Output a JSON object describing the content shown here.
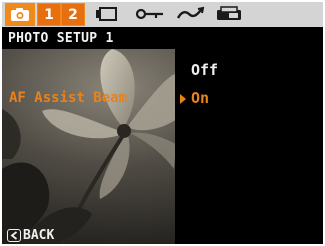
{
  "tabs": [
    {
      "icon": "camera-icon",
      "active": true
    },
    {
      "label": "1",
      "active": false
    },
    {
      "label": "2",
      "active": false
    },
    {
      "icon": "battery-icon",
      "active": false
    },
    {
      "icon": "key-icon",
      "active": false
    },
    {
      "icon": "wave-icon",
      "active": false
    },
    {
      "icon": "printer-icon",
      "active": false
    }
  ],
  "header": {
    "title": "PHOTO SETUP 1"
  },
  "menu": {
    "item_label": "AF Assist Beam",
    "options": [
      {
        "label": "Off",
        "selected": false
      },
      {
        "label": "On",
        "selected": true
      }
    ]
  },
  "footer": {
    "back_label": "BACK",
    "back_icon": "back-arrow-icon"
  },
  "colors": {
    "accent": "#e8821a",
    "tab_active": "#f08a1a",
    "tabbar_bg": "#d4d4d4"
  }
}
